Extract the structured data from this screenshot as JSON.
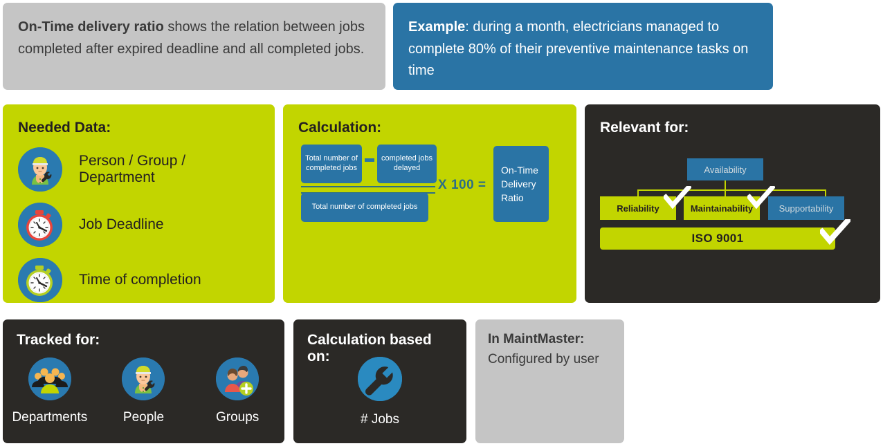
{
  "definition": {
    "term": "On-Time delivery ratio",
    "text": " shows the relation between jobs completed after expired deadline and all completed jobs."
  },
  "example": {
    "label": "Example",
    "text": ": during a month, electricians managed to complete 80% of their preventive maintenance tasks on time"
  },
  "needed_data": {
    "title": "Needed Data:",
    "items": [
      {
        "label": "Person / Group / Department",
        "icon": "worker-wrench-icon"
      },
      {
        "label": "Job Deadline",
        "icon": "red-stopwatch-icon"
      },
      {
        "label": "Time of completion",
        "icon": "green-stopwatch-icon"
      }
    ]
  },
  "calculation": {
    "title": "Calculation:",
    "numerator_left": "Total number of completed jobs",
    "operator": "–",
    "numerator_right": "completed jobs delayed",
    "denominator": "Total number of completed jobs",
    "multiplier": "X 100 =",
    "result": "On-Time Delivery Ratio"
  },
  "relevant_for": {
    "title": "Relevant for:",
    "parent": {
      "label": "Availability",
      "highlighted": false
    },
    "children": [
      {
        "label": "Reliability",
        "highlighted": true,
        "checked": true
      },
      {
        "label": "Maintainability",
        "highlighted": true,
        "checked": true
      },
      {
        "label": "Supportability",
        "highlighted": false,
        "checked": false
      }
    ],
    "standard": {
      "label": "ISO 9001",
      "highlighted": true,
      "checked": true
    }
  },
  "tracked_for": {
    "title": "Tracked for:",
    "items": [
      {
        "label": "Departments",
        "icon": "department-group-icon"
      },
      {
        "label": "People",
        "icon": "worker-wrench-icon"
      },
      {
        "label": "Groups",
        "icon": "add-group-icon"
      }
    ]
  },
  "calculation_based_on": {
    "title": "Calculation based on:",
    "unit_label": "# Jobs",
    "icon": "maintmaster-wrench-logo"
  },
  "in_maintmaster": {
    "title": "In MaintMaster:",
    "value": "Configured by user"
  },
  "colors": {
    "green": "#c2d500",
    "blue": "#2a74a5",
    "dark": "#2b2926",
    "gray": "#c5c5c5",
    "icon_blue": "#2a7ab0"
  }
}
